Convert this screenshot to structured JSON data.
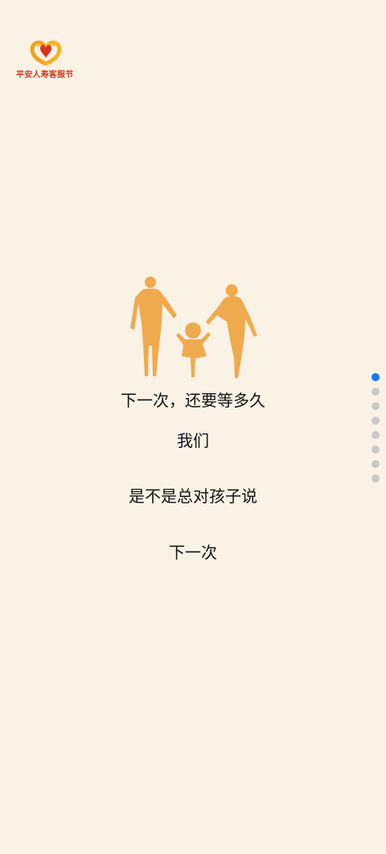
{
  "logo": {
    "text": "平安人寿客服节",
    "colors": {
      "left_heart": "#F2A21B",
      "right_heart": "#F6B324",
      "center": "#D7341F",
      "text": "#D3391B"
    }
  },
  "illustration": {
    "name": "family-holding-hands",
    "color": "#EFAA4D"
  },
  "content": {
    "lines": [
      "下一次，还要等多久",
      "我们",
      "是不是总对孩子说",
      "下一次"
    ]
  },
  "pagination": {
    "total": 8,
    "active_index": 0,
    "colors": {
      "active": "#1677FF",
      "inactive": "#C9C9C9"
    }
  },
  "background": "#FBF2E6"
}
